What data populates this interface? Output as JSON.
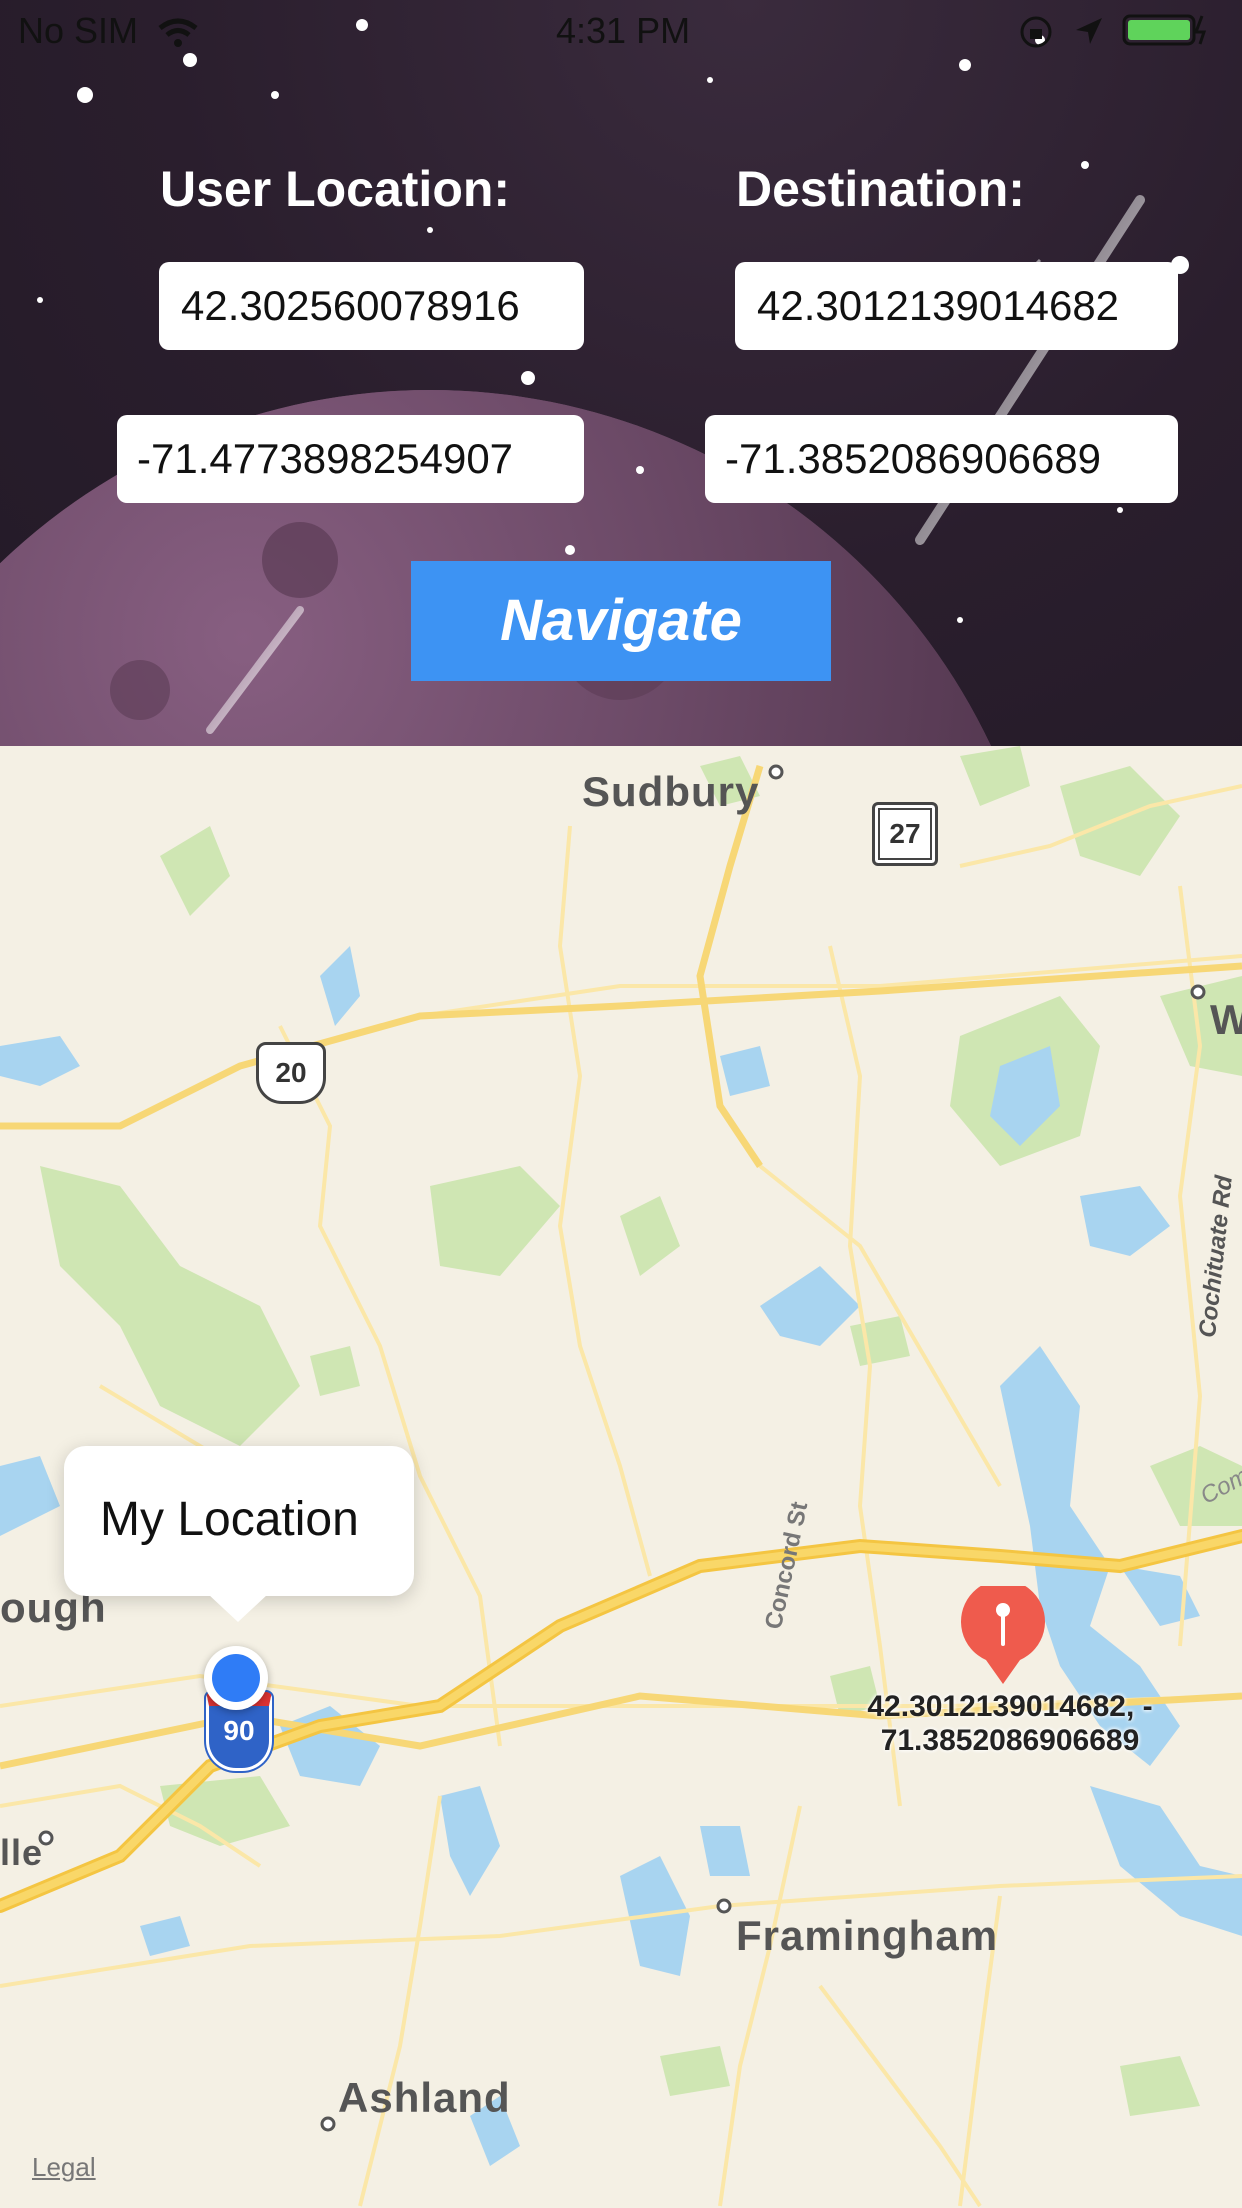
{
  "status_bar": {
    "carrier": "No SIM",
    "time": "4:31 PM"
  },
  "form": {
    "user_location_label": "User Location:",
    "destination_label": "Destination:",
    "user_lat": "42.302560078916",
    "user_lon": "-71.4773898254907",
    "dest_lat": "42.3012139014682",
    "dest_lon": "-71.3852086906689",
    "navigate_label": "Navigate"
  },
  "map": {
    "towns": [
      "Sudbury",
      "Framingham",
      "Ashland",
      "ough",
      "lle",
      "W"
    ],
    "road_labels": [
      "Concord St",
      "Cochituate Rd",
      "Com"
    ],
    "route_shields": [
      "27",
      "20",
      "90"
    ],
    "callout_text": "My Location",
    "pin_label_line1": "42.3012139014682, -",
    "pin_label_line2": "71.3852086906689",
    "legal_link": "Legal",
    "accent_colors": {
      "user_dot": "#2f7cf6",
      "pin": "#ef5b4d",
      "water": "#a8d4f0",
      "park": "#c9e4ad",
      "road": "#f6cc58"
    }
  }
}
